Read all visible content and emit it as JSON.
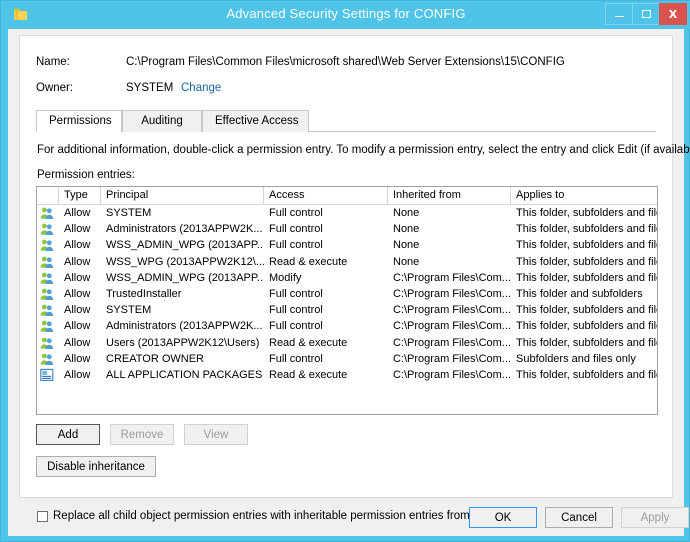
{
  "window": {
    "title": "Advanced Security Settings for CONFIG",
    "icon": "folder-icon",
    "minimize_label": "Minimize",
    "maximize_label": "Maximize",
    "close_label": "X",
    "titlebar_color": "#4fc3e8",
    "close_color": "#d9534f"
  },
  "header": {
    "name_label": "Name:",
    "name_value": "C:\\Program Files\\Common Files\\microsoft shared\\Web Server Extensions\\15\\CONFIG",
    "owner_label": "Owner:",
    "owner_value": "SYSTEM",
    "owner_change_link": "Change",
    "link_color": "#1766a6"
  },
  "tabs": [
    {
      "label": "Permissions",
      "active": true
    },
    {
      "label": "Auditing",
      "active": false
    },
    {
      "label": "Effective Access",
      "active": false
    }
  ],
  "main": {
    "info_text": "For additional information, double-click a permission entry. To modify a permission entry, select the entry and click Edit (if available).",
    "entries_label": "Permission entries:"
  },
  "grid": {
    "columns": [
      "",
      "Type",
      "Principal",
      "Access",
      "Inherited from",
      "Applies to"
    ],
    "rows": [
      {
        "icon": "group-icon",
        "type": "Allow",
        "principal": "SYSTEM",
        "access": "Full control",
        "inherited_from": "None",
        "applies_to": "This folder, subfolders and files"
      },
      {
        "icon": "group-icon",
        "type": "Allow",
        "principal": "Administrators (2013APPW2K...",
        "access": "Full control",
        "inherited_from": "None",
        "applies_to": "This folder, subfolders and files"
      },
      {
        "icon": "group-icon",
        "type": "Allow",
        "principal": "WSS_ADMIN_WPG (2013APP...",
        "access": "Full control",
        "inherited_from": "None",
        "applies_to": "This folder, subfolders and files"
      },
      {
        "icon": "group-icon",
        "type": "Allow",
        "principal": "WSS_WPG (2013APPW2K12\\...",
        "access": "Read & execute",
        "inherited_from": "None",
        "applies_to": "This folder, subfolders and files"
      },
      {
        "icon": "group-icon",
        "type": "Allow",
        "principal": "WSS_ADMIN_WPG (2013APP...",
        "access": "Modify",
        "inherited_from": "C:\\Program Files\\Com...",
        "applies_to": "This folder, subfolders and files"
      },
      {
        "icon": "group-icon",
        "type": "Allow",
        "principal": "TrustedInstaller",
        "access": "Full control",
        "inherited_from": "C:\\Program Files\\Com...",
        "applies_to": "This folder and subfolders"
      },
      {
        "icon": "group-icon",
        "type": "Allow",
        "principal": "SYSTEM",
        "access": "Full control",
        "inherited_from": "C:\\Program Files\\Com...",
        "applies_to": "This folder, subfolders and files"
      },
      {
        "icon": "group-icon",
        "type": "Allow",
        "principal": "Administrators (2013APPW2K...",
        "access": "Full control",
        "inherited_from": "C:\\Program Files\\Com...",
        "applies_to": "This folder, subfolders and files"
      },
      {
        "icon": "group-icon",
        "type": "Allow",
        "principal": "Users (2013APPW2K12\\Users)",
        "access": "Read & execute",
        "inherited_from": "C:\\Program Files\\Com...",
        "applies_to": "This folder, subfolders and files"
      },
      {
        "icon": "group-icon",
        "type": "Allow",
        "principal": "CREATOR OWNER",
        "access": "Full control",
        "inherited_from": "C:\\Program Files\\Com...",
        "applies_to": "Subfolders and files only"
      },
      {
        "icon": "app-package-icon",
        "type": "Allow",
        "principal": "ALL APPLICATION PACKAGES",
        "access": "Read & execute",
        "inherited_from": "C:\\Program Files\\Com...",
        "applies_to": "This folder, subfolders and files"
      }
    ]
  },
  "actions": {
    "add": "Add",
    "remove": "Remove",
    "view": "View",
    "disable_inheritance": "Disable inheritance"
  },
  "replace_checkbox": {
    "label": "Replace all child object permission entries with inheritable permission entries from this object",
    "checked": false
  },
  "footer": {
    "ok": "OK",
    "cancel": "Cancel",
    "apply": "Apply"
  }
}
